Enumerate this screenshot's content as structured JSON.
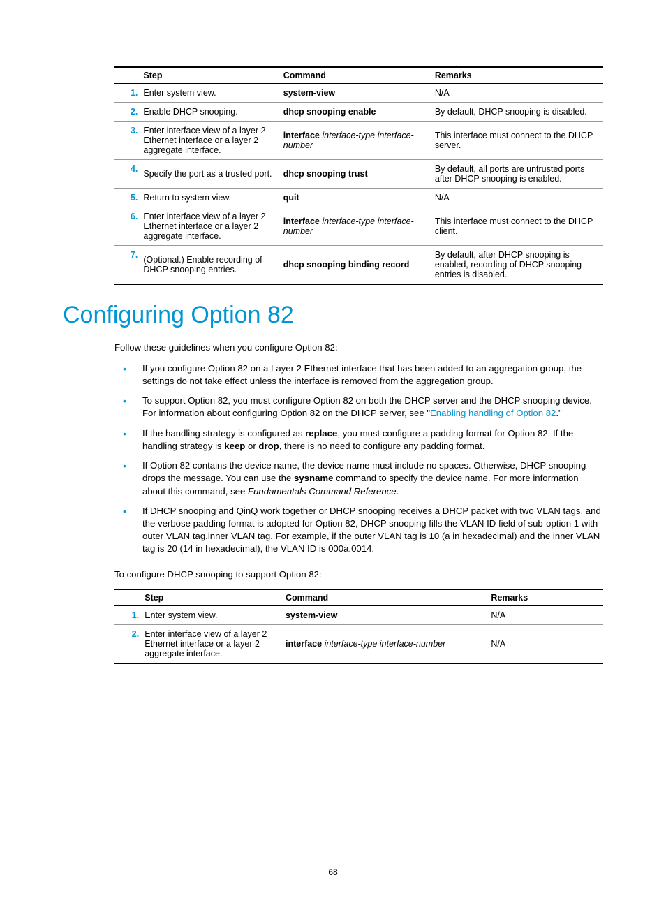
{
  "page_number": "68",
  "table1": {
    "head": {
      "step": "Step",
      "cmd": "Command",
      "rem": "Remarks"
    },
    "rows": [
      {
        "num": "1.",
        "step": "Enter system view.",
        "cmd_b": "system-view",
        "cmd_i": "",
        "rem": "N/A"
      },
      {
        "num": "2.",
        "step": "Enable DHCP snooping.",
        "cmd_b": "dhcp snooping enable",
        "cmd_i": "",
        "rem": "By default, DHCP snooping is disabled."
      },
      {
        "num": "3.",
        "step": "Enter interface view of a layer 2 Ethernet interface or a layer 2 aggregate interface.",
        "cmd_b": "interface",
        "cmd_i": "interface-type interface-number",
        "rem": "This interface must connect to the DHCP server."
      },
      {
        "num": "4.",
        "step": "Specify the port as a trusted port.",
        "cmd_b": "dhcp snooping trust",
        "cmd_i": "",
        "rem": "By default, all ports are untrusted ports after DHCP snooping is enabled."
      },
      {
        "num": "5.",
        "step": "Return to system view.",
        "cmd_b": "quit",
        "cmd_i": "",
        "rem": "N/A"
      },
      {
        "num": "6.",
        "step": "Enter interface view of a layer 2 Ethernet interface or a layer 2 aggregate interface.",
        "cmd_b": "interface",
        "cmd_i": "interface-type interface-number",
        "rem": "This interface must connect to the DHCP client."
      },
      {
        "num": "7.",
        "step": "(Optional.) Enable recording of DHCP snooping entries.",
        "cmd_b": "dhcp snooping binding record",
        "cmd_i": "",
        "rem": "By default, after DHCP snooping is enabled, recording of DHCP snooping entries is disabled."
      }
    ]
  },
  "heading": "Configuring Option 82",
  "intro": "Follow these guidelines when you configure Option 82:",
  "bullets": {
    "b1": "If you configure Option 82 on a Layer 2 Ethernet interface that has been added to an aggregation group, the settings do not take effect unless the interface is removed from the aggregation group.",
    "b2_pre": "To support Option 82, you must configure Option 82 on both the DHCP server and the DHCP snooping device. For information about configuring Option 82 on the DHCP server, see \"",
    "b2_link": "Enabling handling of Option 82",
    "b2_post": ".\"",
    "b3a": "If the handling strategy is configured as ",
    "b3b": "replace",
    "b3c": ", you must configure a padding format for Option 82. If the handling strategy is ",
    "b3d": "keep",
    "b3e": " or ",
    "b3f": "drop",
    "b3g": ", there is no need to configure any padding format.",
    "b4a": "If Option 82 contains the device name, the device name must include no spaces. Otherwise, DHCP snooping drops the message. You can use the ",
    "b4b": "sysname",
    "b4c": " command to specify the device name. For more information about this command, see ",
    "b4d": "Fundamentals Command Reference",
    "b4e": ".",
    "b5": "If DHCP snooping and QinQ work together or DHCP snooping receives a DHCP packet with two VLAN tags, and the verbose padding format is adopted for Option 82, DHCP snooping fills the VLAN ID field of sub-option 1 with outer VLAN tag.inner VLAN tag. For example, if the outer VLAN tag is 10 (a in hexadecimal) and the inner VLAN tag is 20 (14 in hexadecimal), the VLAN ID is 000a.0014."
  },
  "intro2": "To configure DHCP snooping to support Option 82:",
  "table2": {
    "head": {
      "step": "Step",
      "cmd": "Command",
      "rem": "Remarks"
    },
    "rows": [
      {
        "num": "1.",
        "step": "Enter system view.",
        "cmd_b": "system-view",
        "cmd_i": "",
        "rem": "N/A"
      },
      {
        "num": "2.",
        "step": "Enter interface view of a layer 2 Ethernet interface or a layer 2 aggregate interface.",
        "cmd_b": "interface",
        "cmd_i": "interface-type interface-number",
        "rem": "N/A"
      }
    ]
  }
}
